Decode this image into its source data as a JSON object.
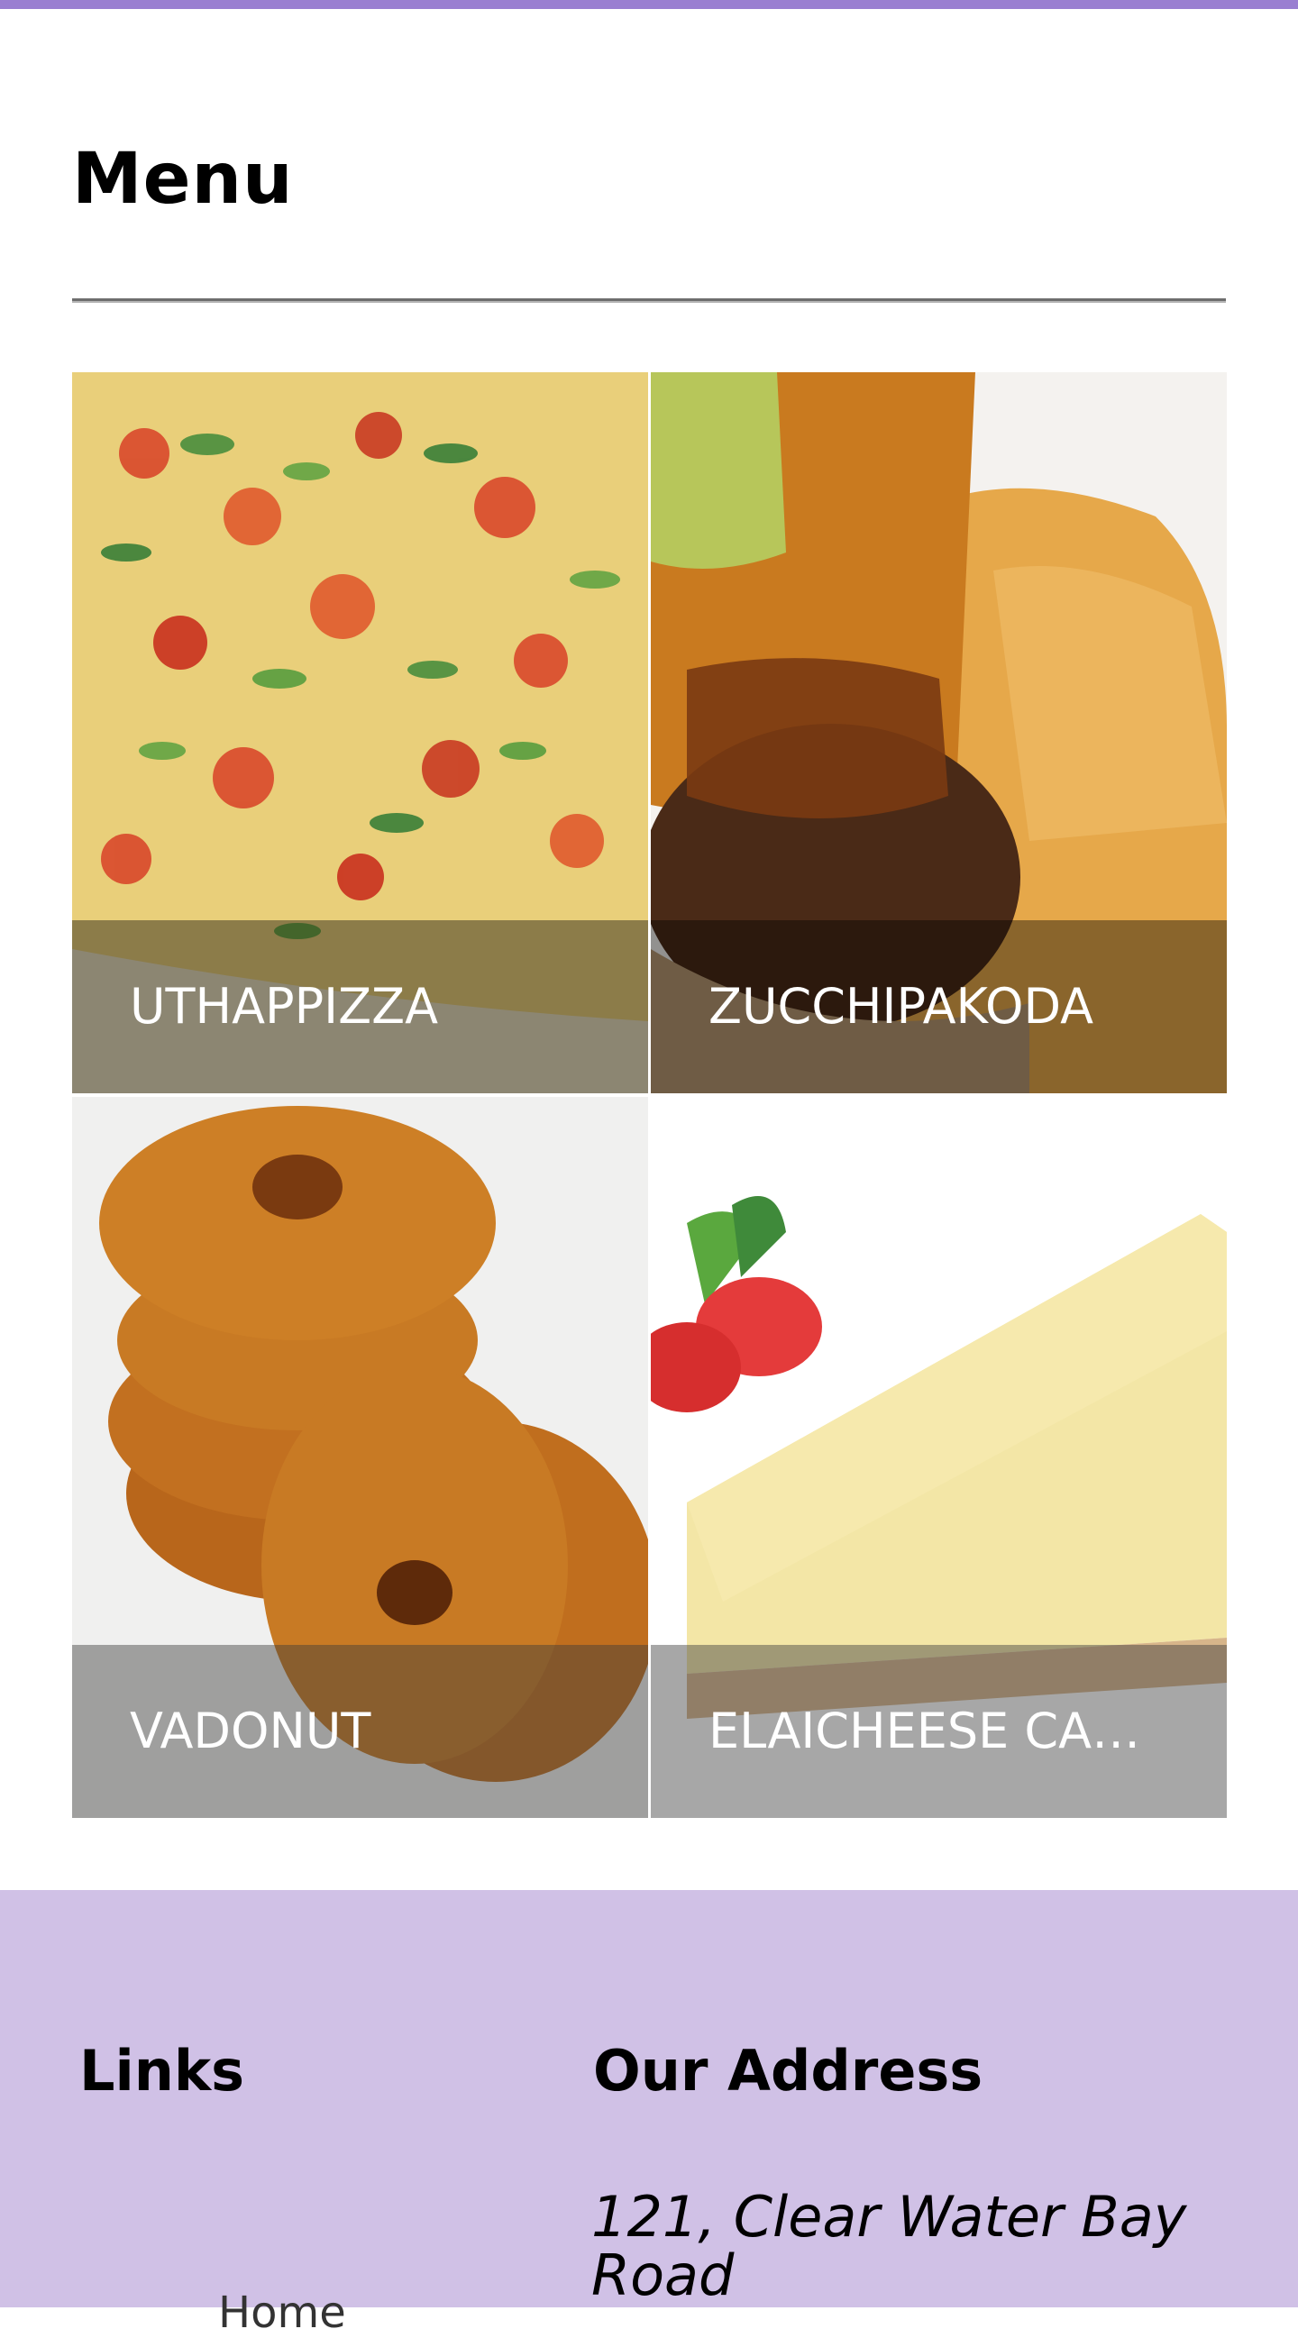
{
  "menu": {
    "title": "Menu",
    "items": [
      {
        "name": "UTHAPPIZZA"
      },
      {
        "name": "ZUCCHIPAKODA"
      },
      {
        "name": "VADONUT"
      },
      {
        "name": "ELAICHEESE CA…"
      }
    ]
  },
  "footer": {
    "links_heading": "Links",
    "links": [
      {
        "label": "Home"
      }
    ],
    "address_heading": "Our Address",
    "address_line1": "121, Clear Water Bay Road"
  },
  "colors": {
    "top_bar": "#9a7fd1",
    "footer_bg": "#d0c1e6"
  }
}
